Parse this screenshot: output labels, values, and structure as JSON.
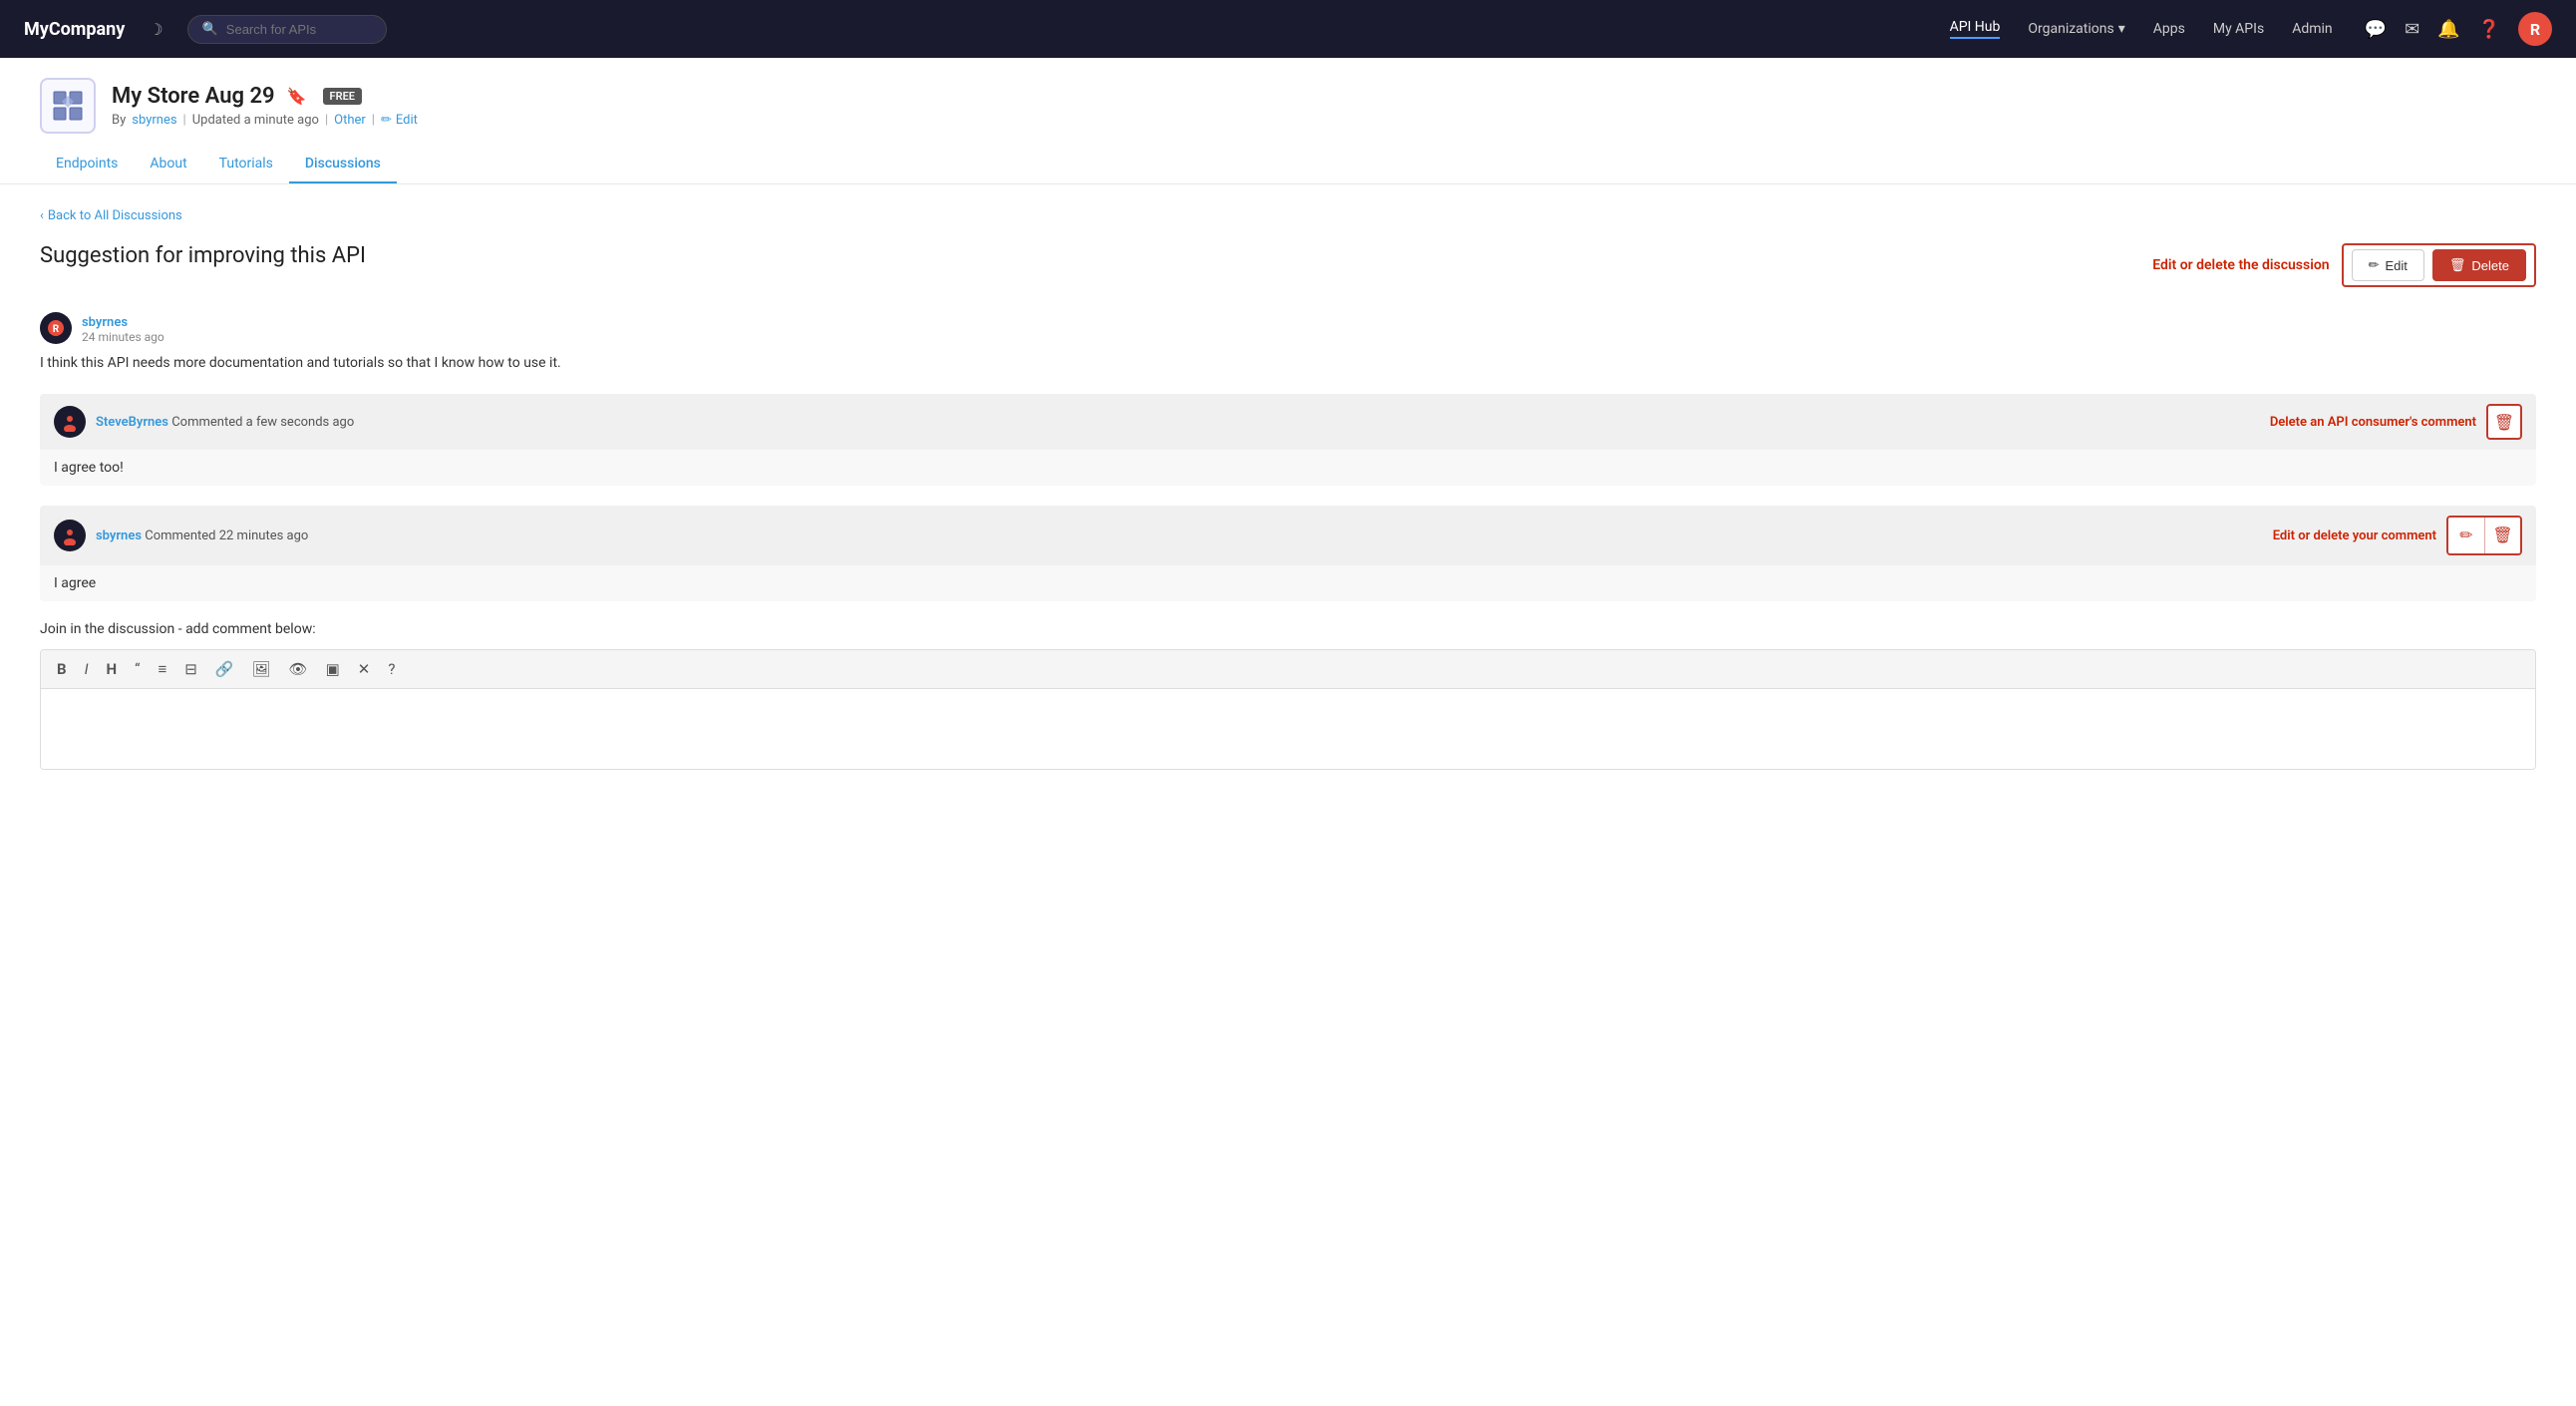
{
  "brand": "MyCompany",
  "navbar": {
    "search_placeholder": "Search for APIs",
    "links": [
      {
        "label": "API Hub",
        "active": true
      },
      {
        "label": "Organizations",
        "has_dropdown": true
      },
      {
        "label": "Apps"
      },
      {
        "label": "My APIs"
      },
      {
        "label": "Admin"
      }
    ],
    "avatar_initial": "R"
  },
  "api": {
    "title": "My Store Aug 29",
    "badge": "FREE",
    "meta_by": "By",
    "author": "sbyrnes",
    "separator1": "|",
    "updated": "Updated a minute ago",
    "separator2": "|",
    "category": "Other",
    "separator3": "|",
    "edit_label": "Edit",
    "bookmark_label": "Bookmark"
  },
  "tabs": [
    {
      "label": "Endpoints",
      "active": false
    },
    {
      "label": "About",
      "active": false
    },
    {
      "label": "Tutorials",
      "active": false
    },
    {
      "label": "Discussions",
      "active": true
    }
  ],
  "discussion": {
    "back_label": "Back to All Discussions",
    "title": "Suggestion for improving this API",
    "edit_delete_label": "Edit or delete the discussion",
    "edit_btn": "Edit",
    "delete_btn": "Delete",
    "original_comment": {
      "author": "sbyrnes",
      "time": "24 minutes ago",
      "body": "I think this API needs more documentation and tutorials so that I know how to use it."
    },
    "replies": [
      {
        "author": "SteveByrnes",
        "action": "Commented",
        "time": "a few seconds ago",
        "body": "I agree too!",
        "action_label": "Delete an API consumer's comment",
        "has_delete": true,
        "has_edit": false
      },
      {
        "author": "sbyrnes",
        "action": "Commented",
        "time": "22 minutes ago",
        "body": "I agree",
        "action_label": "Edit or delete your comment",
        "has_delete": true,
        "has_edit": true
      }
    ],
    "join_label": "Join in the discussion - add comment below:",
    "editor_tools": [
      "B",
      "I",
      "H",
      "❝",
      "☰",
      "☷",
      "🔗",
      "🖼",
      "👁",
      "▣",
      "✕",
      "?"
    ]
  }
}
